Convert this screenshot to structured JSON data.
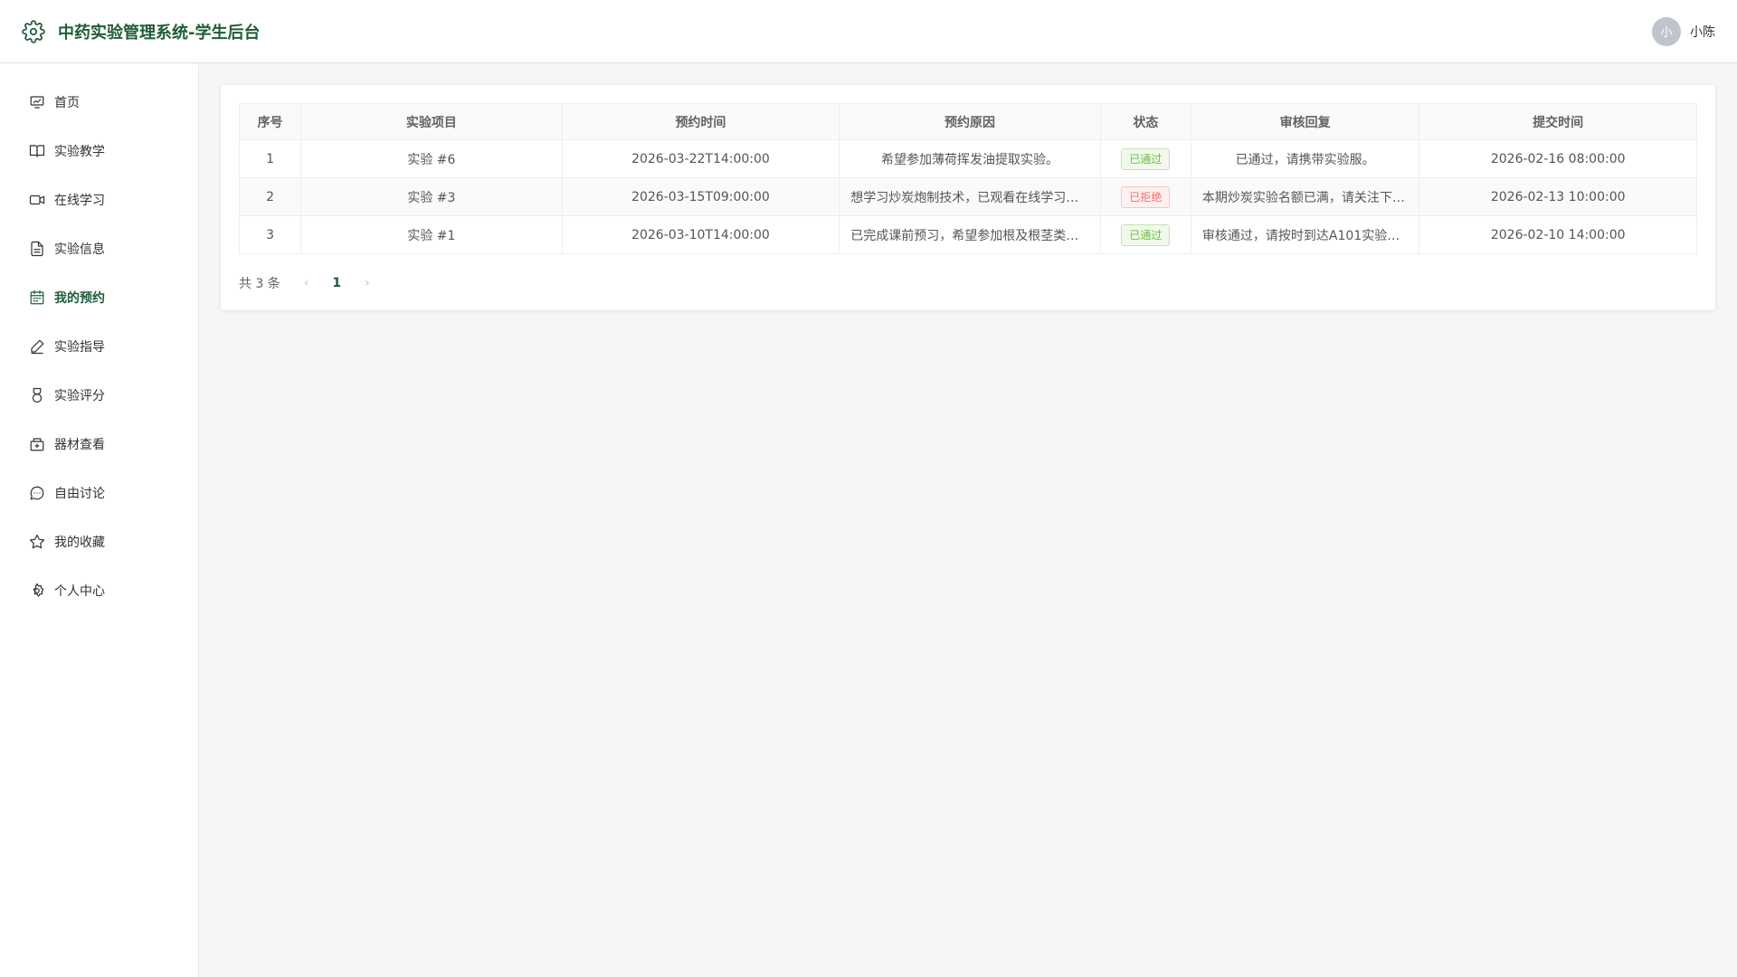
{
  "header": {
    "title": "中药实验管理系统-学生后台",
    "avatar_text": "小",
    "username": "小陈"
  },
  "sidebar": {
    "items": [
      {
        "label": "首页",
        "icon": "home-chart-icon"
      },
      {
        "label": "实验教学",
        "icon": "book-icon"
      },
      {
        "label": "在线学习",
        "icon": "video-camera-icon"
      },
      {
        "label": "实验信息",
        "icon": "document-icon"
      },
      {
        "label": "我的预约",
        "icon": "calendar-icon",
        "active": true
      },
      {
        "label": "实验指导",
        "icon": "edit-pen-icon"
      },
      {
        "label": "实验评分",
        "icon": "medal-icon"
      },
      {
        "label": "器材查看",
        "icon": "box-icon"
      },
      {
        "label": "自由讨论",
        "icon": "chat-icon"
      },
      {
        "label": "我的收藏",
        "icon": "star-icon"
      },
      {
        "label": "个人中心",
        "icon": "settings-icon"
      }
    ]
  },
  "table": {
    "headers": [
      "序号",
      "实验项目",
      "预约时间",
      "预约原因",
      "状态",
      "审核回复",
      "提交时间"
    ],
    "rows": [
      {
        "index": "1",
        "project": "实验 #6",
        "time": "2026-03-22T14:00:00",
        "reason": "希望参加薄荷挥发油提取实验。",
        "status": "已通过",
        "reply": "已通过，请携带实验服。",
        "submitted": "2026-02-16 08:00:00"
      },
      {
        "index": "2",
        "project": "实验 #3",
        "time": "2026-03-15T09:00:00",
        "reason": "想学习炒炭炮制技术，已观看在线学习…",
        "status": "已拒绝",
        "reply": "本期炒炭实验名额已满，请关注下…",
        "submitted": "2026-02-13 10:00:00"
      },
      {
        "index": "3",
        "project": "实验 #1",
        "time": "2026-03-10T14:00:00",
        "reason": "已完成课前预习，希望参加根及根茎类…",
        "status": "已通过",
        "reply": "审核通过，请按时到达A101实验…",
        "submitted": "2026-02-10 14:00:00"
      }
    ]
  },
  "pagination": {
    "total_text": "共 3 条",
    "current_page": "1",
    "prev": "‹",
    "next": "›"
  },
  "colors": {
    "brand": "#1f5c3a",
    "approved": "#67c23a",
    "rejected": "#f56c6c"
  }
}
